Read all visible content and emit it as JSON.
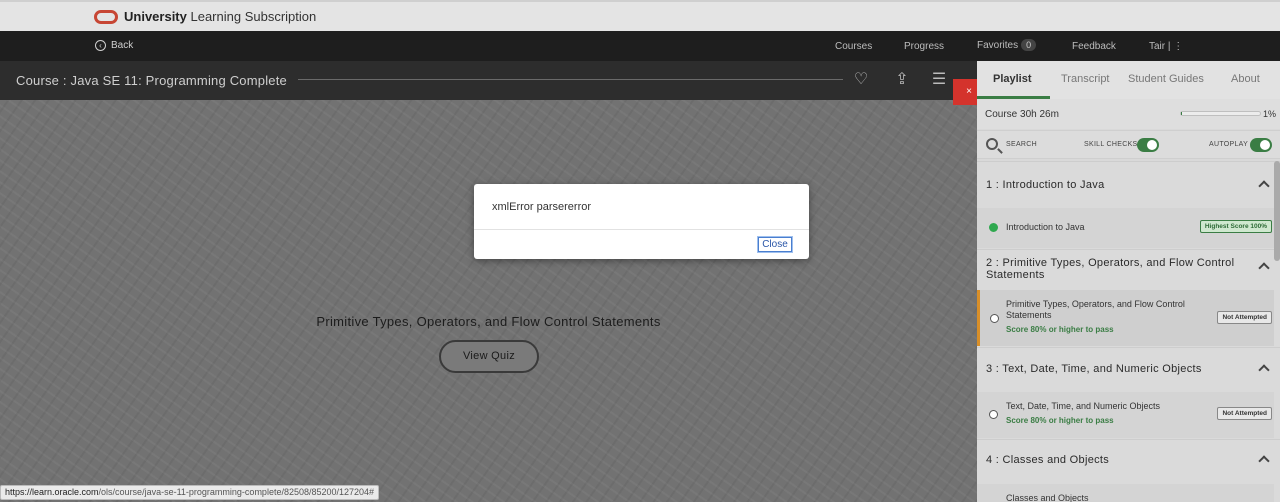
{
  "brand": {
    "bold": "University",
    "rest": " Learning Subscription"
  },
  "nav": {
    "back": "Back",
    "links": [
      "Courses",
      "Progress"
    ],
    "favorites": "Favorites",
    "favorites_count": "0",
    "feedback": "Feedback",
    "user": "Tair  |  ⋮"
  },
  "course": {
    "title": "Course : Java SE 11: Programming Complete"
  },
  "stage": {
    "title": "Primitive Types, Operators, and Flow Control Statements",
    "button": "View Quiz"
  },
  "dialog": {
    "message": "xmlError parsererror",
    "close": "Close"
  },
  "close_x": "×",
  "panel": {
    "tabs": [
      "Playlist",
      "Transcript",
      "Student Guides",
      "About"
    ],
    "course_length": "Course 30h 26m",
    "progress_pct": "1%",
    "progress_value": 1,
    "search": "SEARCH",
    "skill_checks": "SKILL CHECKS",
    "autoplay": "AUTOPLAY",
    "sections": [
      {
        "title": "1 :  Introduction to Java",
        "item": "Introduction to Java",
        "sub": "",
        "badge": "Highest Score 100%"
      },
      {
        "title": "2 :  Primitive Types, Operators, and Flow Control Statements",
        "item": "Primitive Types, Operators, and Flow Control Statements",
        "sub": "Score 80% or higher to pass",
        "badge": "Not Attempted"
      },
      {
        "title": "3 :  Text, Date, Time, and Numeric Objects",
        "item": "Text, Date, Time, and Numeric Objects",
        "sub": "Score 80% or higher to pass",
        "badge": "Not Attempted"
      },
      {
        "title": "4 :  Classes and Objects",
        "item": "Classes and Objects",
        "sub": "",
        "badge": ""
      }
    ]
  },
  "status": {
    "host": "https://learn.oracle.com",
    "path": "/ols/course/java-se-11-programming-complete/82508/85200/127204#"
  },
  "colors": {
    "accent_green": "#3a7d44",
    "close_red": "#d4332c",
    "current_marker": "#d98f28"
  }
}
